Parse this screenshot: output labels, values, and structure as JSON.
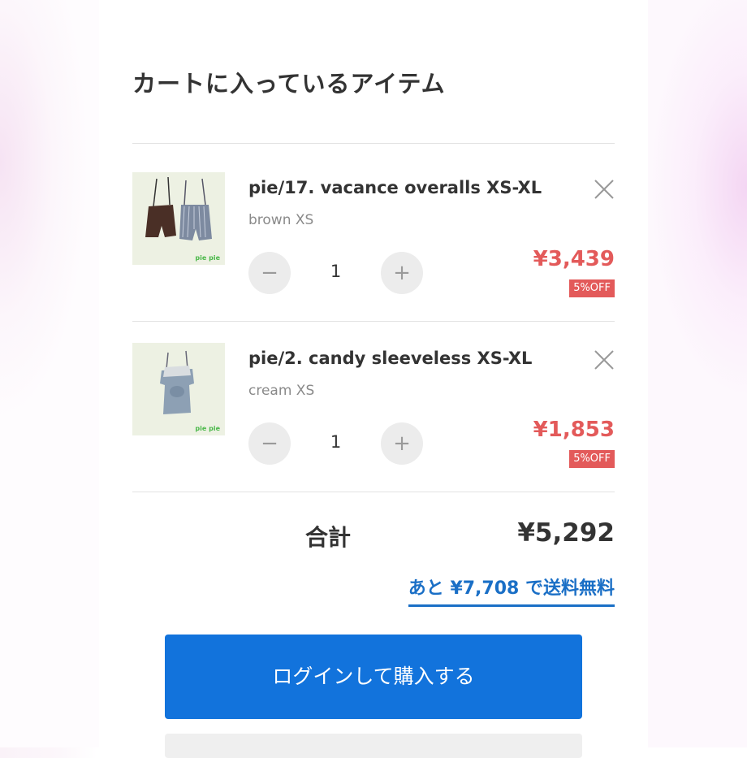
{
  "cart": {
    "title": "カートに入っているアイテム",
    "items": [
      {
        "name": "pie/17. vacance overalls XS-XL",
        "variant": "brown XS",
        "quantity": "1",
        "price": "¥3,439",
        "badge": "5%OFF",
        "brand_mark": "pie pie",
        "minus_symbol": "−",
        "plus_symbol": "+"
      },
      {
        "name": "pie/2. candy sleeveless XS-XL",
        "variant": "cream XS",
        "quantity": "1",
        "price": "¥1,853",
        "badge": "5%OFF",
        "brand_mark": "pie pie",
        "minus_symbol": "−",
        "plus_symbol": "+"
      }
    ],
    "total_label": "合計",
    "total_value": "¥5,292",
    "free_shipping_note": "あと ¥7,708 で送料無料",
    "login_button": "ログインして購入する"
  },
  "colors": {
    "accent_blue": "#1273dc",
    "link_blue": "#1a6fc6",
    "sale_red": "#e35a5a"
  },
  "icons": {
    "remove": "close-icon",
    "decrease": "minus-icon",
    "increase": "plus-icon"
  }
}
